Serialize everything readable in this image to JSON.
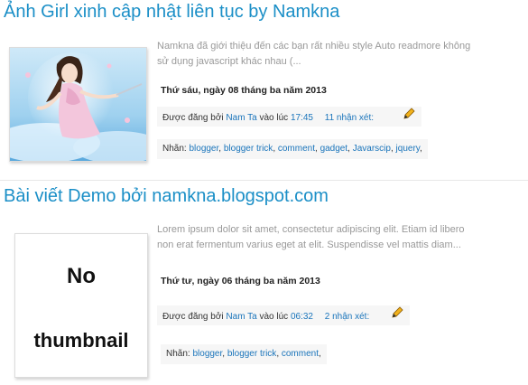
{
  "posts": [
    {
      "title": "Ảnh Girl xinh cập nhật liên tục by Namkna",
      "summary_line1": "Namkna đã giới thiệu đến các bạn rất nhiều style Auto readmore không",
      "summary_line2": "sử dụng javascript khác nhau (...",
      "date": "Thứ sáu, ngày 08 tháng ba năm 2013",
      "posted_by_label": "Được đăng bởi",
      "author": "Nam Ta",
      "at_label": "vào lúc",
      "time": "17:45",
      "comments": "11 nhận xét:",
      "labels_prefix": "Nhãn:",
      "labels": [
        "blogger",
        "blogger trick",
        "comment",
        "gadget",
        "Javarscip",
        "jquery"
      ],
      "thumbnail": "girl-illustration-thumbnail"
    },
    {
      "title": "Bài viết Demo bởi namkna.blogspot.com",
      "summary_line1": "Lorem ipsum dolor sit amet, consectetur adipiscing elit. Etiam id libero",
      "summary_line2": "non erat fermentum varius eget at elit. Suspendisse vel mattis diam...",
      "date": "Thứ tư, ngày 06 tháng ba năm 2013",
      "posted_by_label": "Được đăng bởi",
      "author": "Nam Ta",
      "at_label": "vào lúc",
      "time": "06:32",
      "comments": "2 nhận xét:",
      "labels_prefix": "Nhãn:",
      "labels": [
        "blogger",
        "blogger trick",
        "comment"
      ],
      "no_thumb_line1": "No",
      "no_thumb_line2": "thumbnail"
    }
  ],
  "colors": {
    "title": "#1b8fc7",
    "link": "#1b75bb",
    "summary": "#999999",
    "meta_bg": "#f6f6f6"
  },
  "icons": [
    "edit-pencil-icon"
  ]
}
